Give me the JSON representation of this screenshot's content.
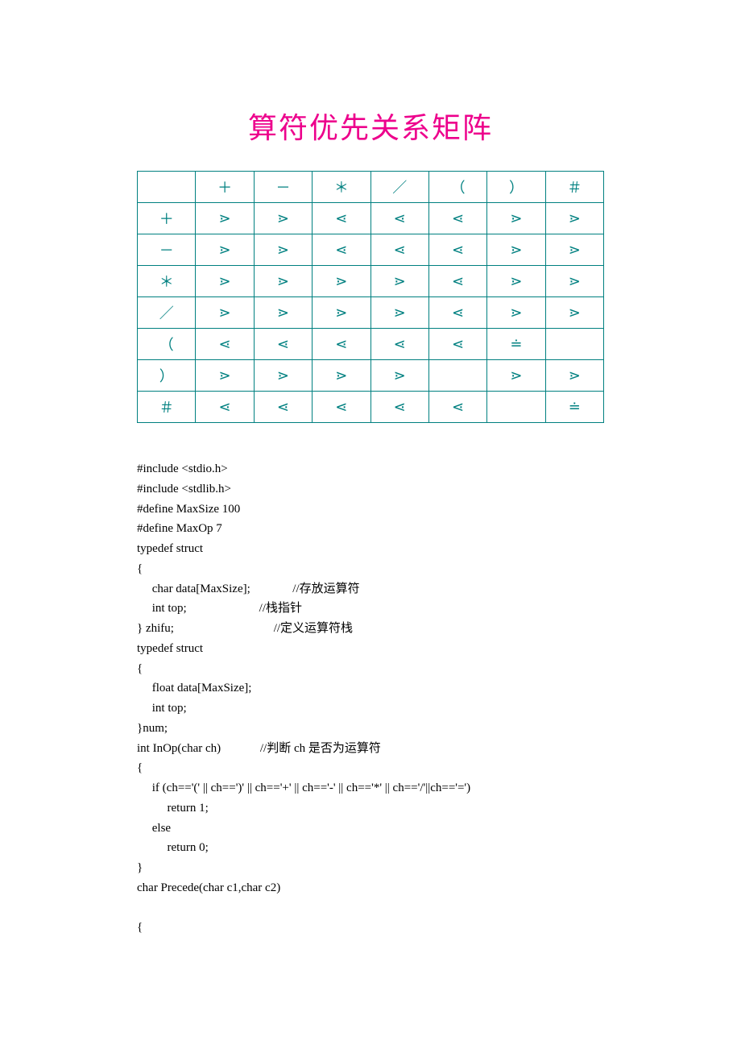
{
  "title": "算符优先关系矩阵",
  "table": {
    "headers": [
      "",
      "＋",
      "－",
      "＊",
      "／",
      "（",
      "）",
      "＃"
    ],
    "rows": [
      [
        "＋",
        "⋗",
        "⋗",
        "⋖",
        "⋖",
        "⋖",
        "⋗",
        "⋗"
      ],
      [
        "－",
        "⋗",
        "⋗",
        "⋖",
        "⋖",
        "⋖",
        "⋗",
        "⋗"
      ],
      [
        "＊",
        "⋗",
        "⋗",
        "⋗",
        "⋗",
        "⋖",
        "⋗",
        "⋗"
      ],
      [
        "／",
        "⋗",
        "⋗",
        "⋗",
        "⋗",
        "⋖",
        "⋗",
        "⋗"
      ],
      [
        "（",
        "⋖",
        "⋖",
        "⋖",
        "⋖",
        "⋖",
        "≐",
        ""
      ],
      [
        "）",
        "⋗",
        "⋗",
        "⋗",
        "⋗",
        "",
        "⋗",
        "⋗"
      ],
      [
        "＃",
        "⋖",
        "⋖",
        "⋖",
        "⋖",
        "⋖",
        "",
        "≐"
      ]
    ]
  },
  "code_lines": [
    "#include <stdio.h>",
    "#include <stdlib.h>",
    "#define MaxSize 100",
    "#define MaxOp 7",
    "typedef struct",
    "{",
    "     char data[MaxSize];              //存放运算符",
    "     int top;                        //栈指针",
    "} zhifu;                                 //定义运算符栈",
    "typedef struct",
    "{",
    "     float data[MaxSize];",
    "     int top;",
    "}num;",
    "int InOp(char ch)             //判断 ch 是否为运算符",
    "{",
    "     if (ch=='(' || ch==')' || ch=='+' || ch=='-' || ch=='*' || ch=='/'||ch=='=')",
    "          return 1;",
    "     else",
    "          return 0;",
    "}",
    "char Precede(char c1,char c2)",
    "",
    "{"
  ]
}
